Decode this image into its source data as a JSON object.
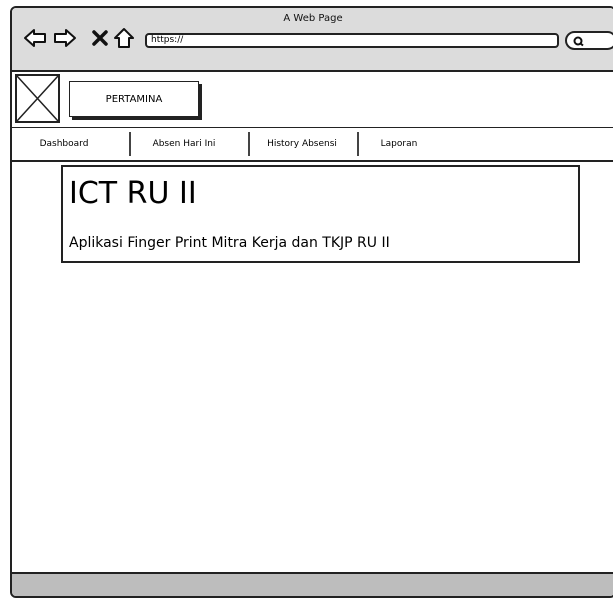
{
  "window": {
    "title": "A Web Page"
  },
  "toolbar": {
    "back_icon": "back-arrow-icon",
    "forward_icon": "forward-arrow-icon",
    "close_icon": "close-icon",
    "home_icon": "home-icon",
    "url": "https://",
    "search_icon": "search-icon"
  },
  "header": {
    "brand_label": "PERTAMINA",
    "logo_icon": "image-placeholder-icon"
  },
  "nav": {
    "items": [
      {
        "label": "Dashboard"
      },
      {
        "label": "Absen Hari Ini"
      },
      {
        "label": "History Absensi"
      },
      {
        "label": "Laporan"
      }
    ]
  },
  "hero": {
    "title": "ICT RU II",
    "subtitle": "Aplikasi Finger Print Mitra Kerja dan TKJP RU II"
  },
  "colors": {
    "chrome": "#dcdcdc",
    "statusbar": "#bdbdbd",
    "outline": "#222222"
  }
}
